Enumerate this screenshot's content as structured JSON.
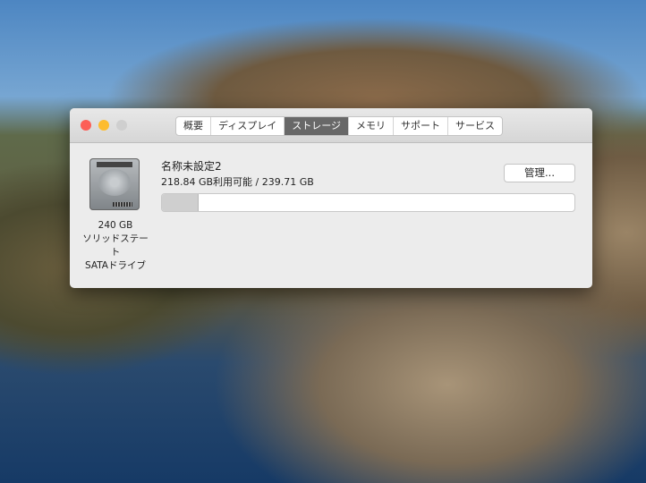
{
  "tabs": [
    {
      "label": "概要"
    },
    {
      "label": "ディスプレイ"
    },
    {
      "label": "ストレージ",
      "active": true
    },
    {
      "label": "メモリ"
    },
    {
      "label": "サポート"
    },
    {
      "label": "サービス"
    }
  ],
  "disk": {
    "capacity": "240 GB",
    "type_line1": "ソリッドステート",
    "type_line2": "SATAドライブ",
    "icon": "ssd-drive-icon"
  },
  "volume": {
    "name": "名称未設定2",
    "availability": "218.84 GB利用可能 / 239.71 GB",
    "used_fraction": 0.087
  },
  "manage_label": "管理...",
  "colors": {
    "close": "#fc5f57",
    "minimize": "#fdbc2e",
    "zoom": "#cfcfcf",
    "active_tab": "#686868"
  }
}
